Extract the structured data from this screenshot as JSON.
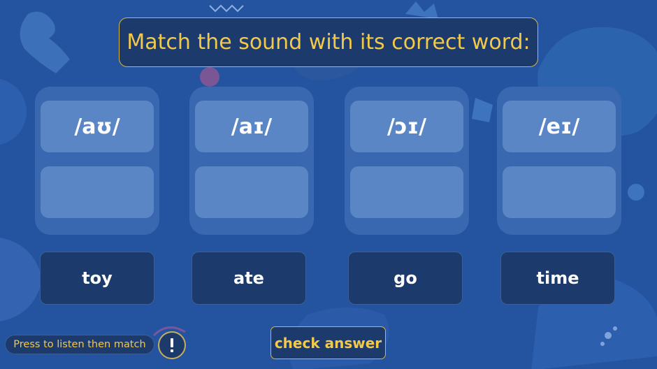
{
  "prompt": {
    "title": "Match the sound with its correct word:"
  },
  "sounds": [
    {
      "symbol": "/aʊ/"
    },
    {
      "symbol": "/aɪ/"
    },
    {
      "symbol": "/ɔɪ/"
    },
    {
      "symbol": "/eɪ/"
    }
  ],
  "words": [
    {
      "label": "toy"
    },
    {
      "label": "ate"
    },
    {
      "label": "go"
    },
    {
      "label": "time"
    }
  ],
  "controls": {
    "check_label": "check answer",
    "instruction": "Press to listen then match",
    "listen_icon": "exclamation-icon"
  },
  "colors": {
    "background": "#2453a0",
    "panel": "#1c3a6c",
    "accent_gold": "#f3c94a",
    "card": "#5a86c6",
    "column": "#3a68b0"
  }
}
